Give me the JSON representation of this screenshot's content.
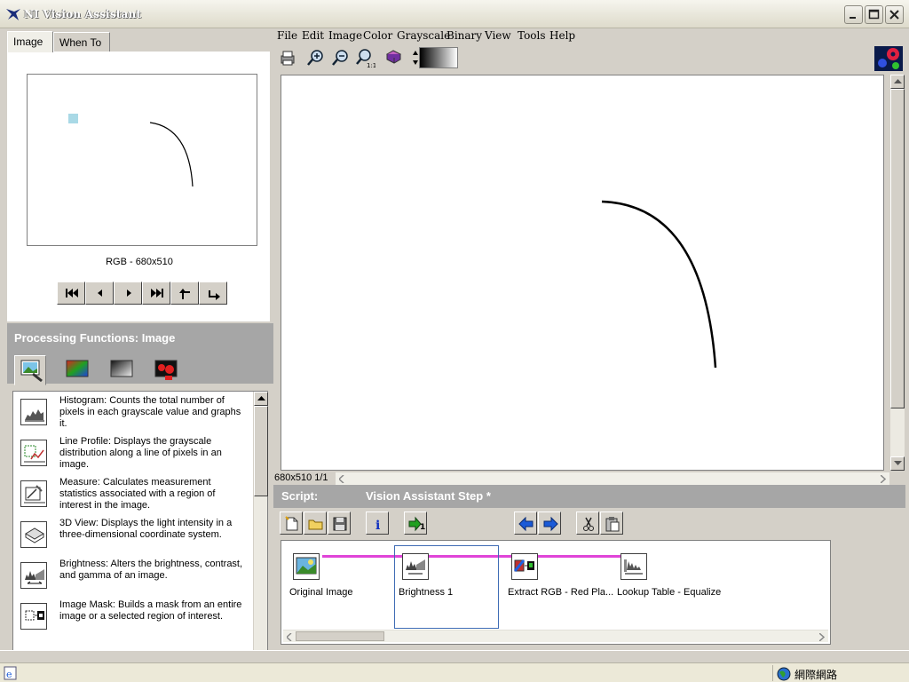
{
  "window": {
    "title": "NI Vision Assistant"
  },
  "left_panel": {
    "tabs": [
      "Image",
      "When To"
    ],
    "preview_info": "RGB - 680x510",
    "processing_header": "Processing Functions: Image",
    "functions": [
      {
        "icon": "histogram-icon",
        "text": "Histogram:  Counts the total number of pixels in each grayscale value and graphs it."
      },
      {
        "icon": "line-profile-icon",
        "text": "Line Profile:  Displays the grayscale distribution along a line of pixels in an image."
      },
      {
        "icon": "measure-icon",
        "text": "Measure:  Calculates measurement statistics associated with a region of interest in the image."
      },
      {
        "icon": "3d-view-icon",
        "text": "3D View:  Displays the light intensity in a three-dimensional coordinate system."
      },
      {
        "icon": "brightness-icon",
        "text": "Brightness:  Alters the brightness, contrast, and gamma of an image."
      },
      {
        "icon": "image-mask-icon",
        "text": "Image Mask:  Builds a mask from an entire image or a selected region of interest."
      }
    ]
  },
  "menubar": [
    "File",
    "Edit",
    "Image",
    "Color",
    "Grayscale",
    "Binary",
    "View",
    "Tools",
    "Help"
  ],
  "canvas": {
    "info": "680x510 1/1"
  },
  "script": {
    "label": "Script:",
    "name": "Vision Assistant Step *",
    "steps": [
      "Original Image",
      "Brightness 1",
      "Extract RGB - Red Pla...",
      "Lookup Table - Equalize"
    ]
  },
  "statusbar": {
    "network": "網際網路"
  },
  "colors": {
    "panel_gray": "#a6a6a6",
    "step_line": "#e044d8",
    "selection": "#3f6cb5"
  }
}
